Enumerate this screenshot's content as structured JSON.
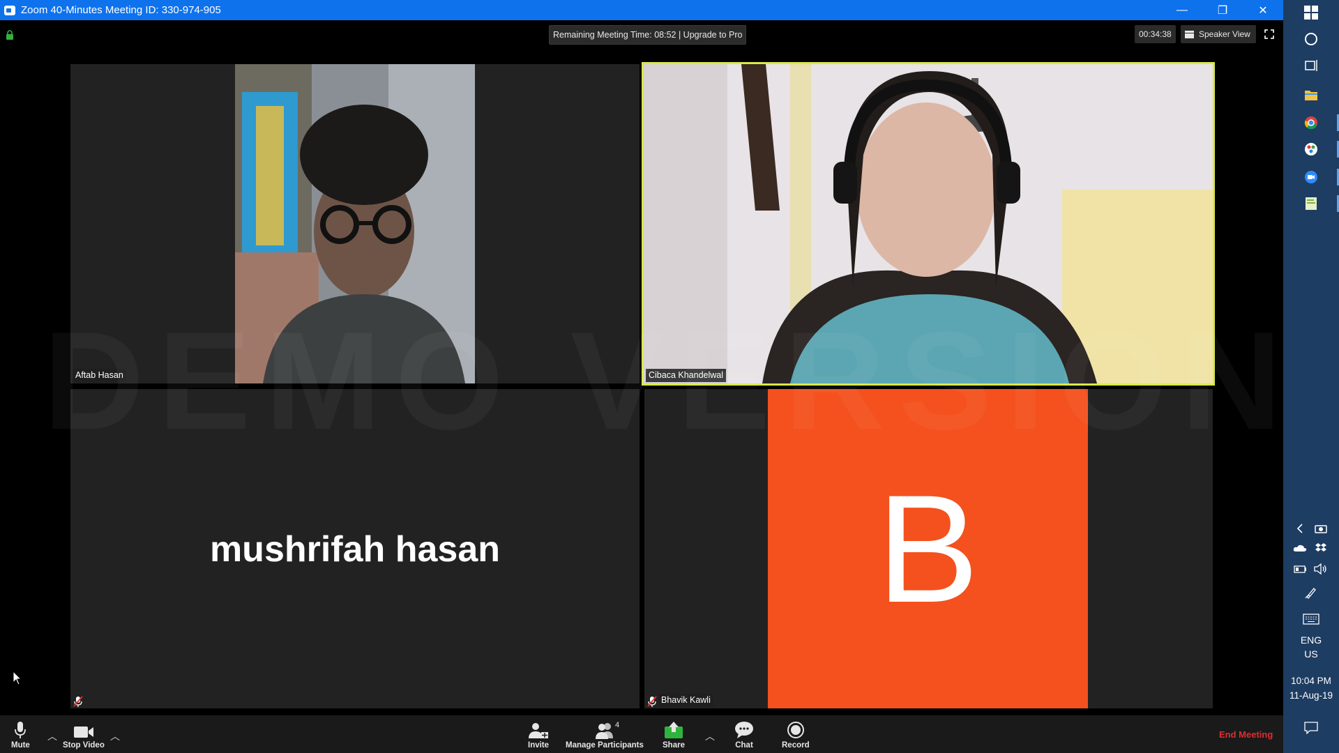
{
  "window": {
    "title": "Zoom 40-Minutes Meeting ID: 330-974-905",
    "minimize": "—",
    "restore": "❐",
    "close": "✕"
  },
  "topbar": {
    "remaining_time": "Remaining Meeting Time: 08:52 | Upgrade to Pro",
    "elapsed": "00:34:38",
    "view_button": "Speaker View"
  },
  "participants": [
    {
      "name": "Aftab Hasan",
      "video": true
    },
    {
      "name": "Cibaca Khandelwal",
      "video": true,
      "active_speaker": true
    },
    {
      "name": "mushrifah hasan",
      "video": false,
      "muted": true
    },
    {
      "name": "Bhavik Kawli",
      "video": false,
      "muted": true,
      "avatar_letter": "B",
      "avatar_color": "#f4511e"
    }
  ],
  "watermark": "DEMO VERSION",
  "toolbar": {
    "mute": "Mute",
    "stop_video": "Stop Video",
    "invite": "Invite",
    "manage_participants": "Manage Participants",
    "participant_count": "4",
    "share": "Share",
    "chat": "Chat",
    "record": "Record",
    "end_meeting": "End Meeting"
  },
  "system_tray": {
    "lang_line1": "ENG",
    "lang_line2": "US",
    "time": "10:04 PM",
    "date": "11-Aug-19"
  },
  "colors": {
    "titlebar": "#0e72ed",
    "active_speaker_border": "#d9e84b",
    "end_meeting": "#e02d2d",
    "share_green": "#2fb33f",
    "taskbar": "#1e3d63"
  }
}
